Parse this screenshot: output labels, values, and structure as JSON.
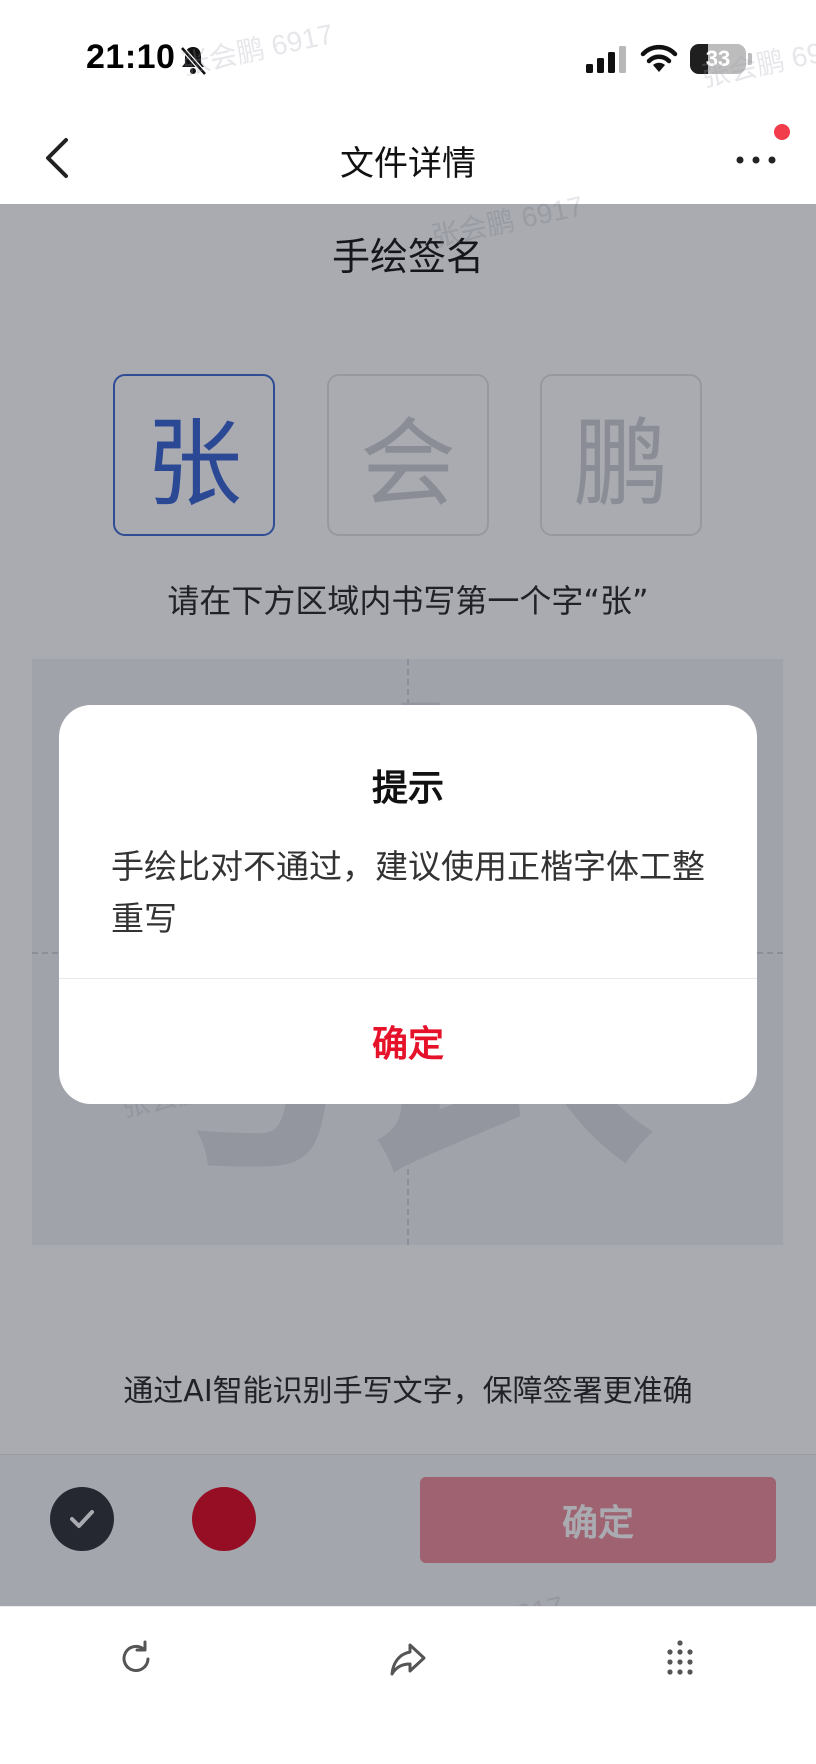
{
  "status_bar": {
    "time": "21:10",
    "battery": "33",
    "battery_level_percent": 33,
    "icons": [
      "bell-muted-icon",
      "cellular-signal-icon",
      "wifi-icon",
      "battery-icon"
    ]
  },
  "nav": {
    "title": "文件详情",
    "back_icon": "chevron-left-icon",
    "more_icon": "more-dots-icon",
    "notification_color": "#f23c4b"
  },
  "signature": {
    "title": "手绘签名",
    "characters": [
      {
        "char": "张",
        "active": true
      },
      {
        "char": "会",
        "active": false
      },
      {
        "char": "鹏",
        "active": false
      }
    ],
    "instruction": "请在下方区域内书写第一个字“张”",
    "canvas_guide_char": "张",
    "hint": "通过AI智能识别手写文字，保障签署更准确",
    "pen_colors": [
      "#2a2c31",
      "#e0021c"
    ],
    "confirm_label": "确定"
  },
  "dialog": {
    "title": "提示",
    "message": "手绘比对不通过，建议使用正楷字体工整重写",
    "button_label": "确定",
    "button_color": "#e6122a"
  },
  "bottom_bar": {
    "icons": [
      "refresh-icon",
      "share-icon",
      "grid-dots-icon"
    ]
  },
  "watermark": {
    "text": "张会鹏 6917"
  },
  "colors": {
    "accent_blue": "#3560d2",
    "brand_red": "#e6122a"
  }
}
